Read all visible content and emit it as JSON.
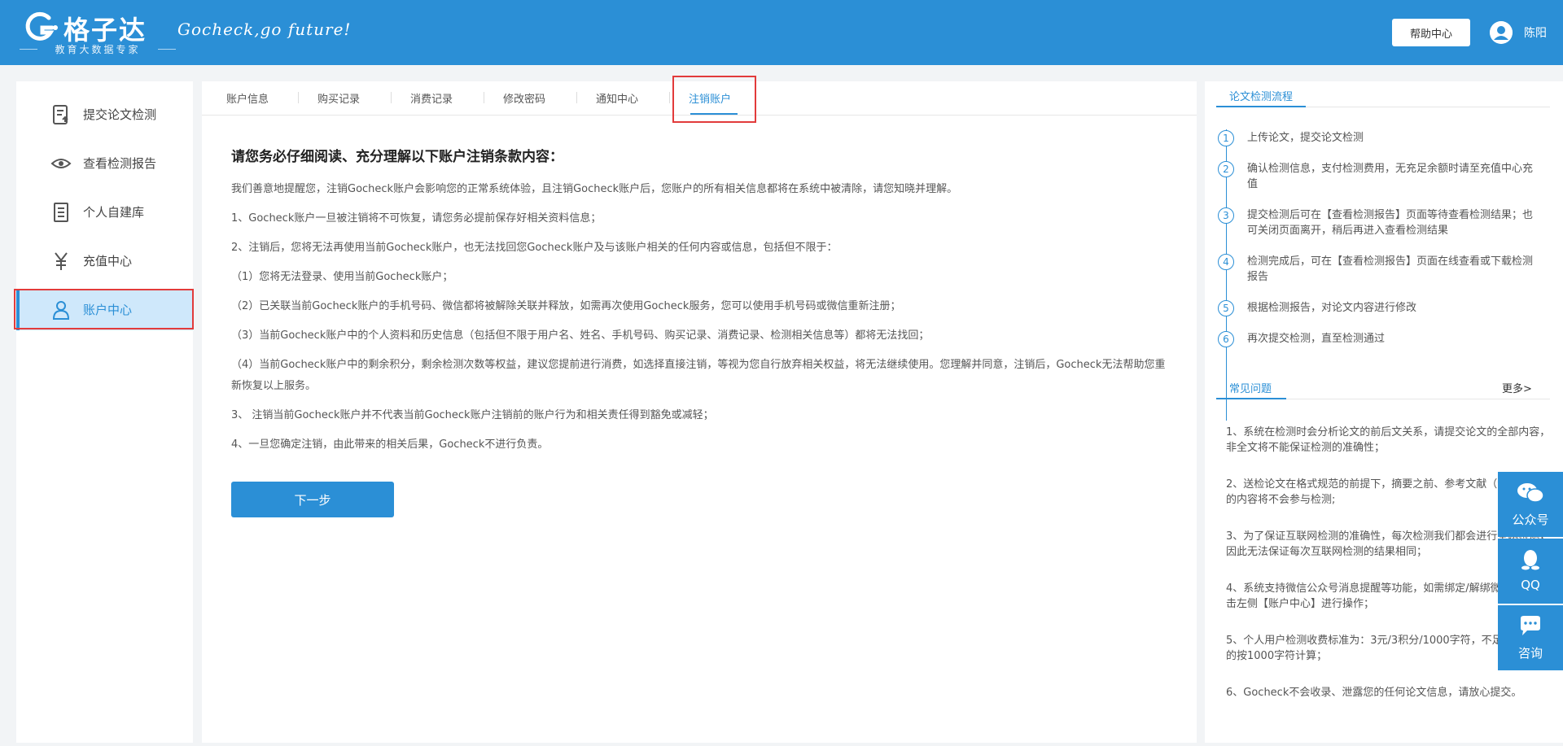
{
  "header": {
    "logo_name": "格子达",
    "logo_sub": "教育大数据专家",
    "slogan": "Gocheck,go future!",
    "help_label": "帮助中心",
    "user_name": "陈阳"
  },
  "sidebar": {
    "items": [
      {
        "label": "提交论文检测",
        "icon": "document-upload-icon"
      },
      {
        "label": "查看检测报告",
        "icon": "eye-icon"
      },
      {
        "label": "个人自建库",
        "icon": "list-document-icon"
      },
      {
        "label": "充值中心",
        "icon": "yen-icon"
      },
      {
        "label": "账户中心",
        "icon": "user-icon",
        "active": true
      }
    ]
  },
  "tabs": [
    {
      "label": "账户信息"
    },
    {
      "label": "购买记录"
    },
    {
      "label": "消费记录"
    },
    {
      "label": "修改密码"
    },
    {
      "label": "通知中心"
    },
    {
      "label": "注销账户",
      "active": true
    }
  ],
  "content": {
    "title": "请您务必仔细阅读、充分理解以下账户注销条款内容：",
    "paragraphs": [
      "我们善意地提醒您，注销Gocheck账户会影响您的正常系统体验，且注销Gocheck账户后，您账户的所有相关信息都将在系统中被清除，请您知晓并理解。",
      "1、Gocheck账户一旦被注销将不可恢复，请您务必提前保存好相关资料信息；",
      "2、注销后，您将无法再使用当前Gocheck账户，也无法找回您Gocheck账户及与该账户相关的任何内容或信息，包括但不限于：",
      "（1）您将无法登录、使用当前Gocheck账户；",
      "（2）已关联当前Gocheck账户的手机号码、微信都将被解除关联并释放，如需再次使用Gocheck服务，您可以使用手机号码或微信重新注册；",
      "（3）当前Gocheck账户中的个人资料和历史信息（包括但不限于用户名、姓名、手机号码、购买记录、消费记录、检测相关信息等）都将无法找回；",
      "（4）当前Gocheck账户中的剩余积分，剩余检测次数等权益，建议您提前进行消费，如选择直接注销，等视为您自行放弃相关权益，将无法继续使用。您理解并同意，注销后，Gocheck无法帮助您重新恢复以上服务。",
      "3、 注销当前Gocheck账户并不代表当前Gocheck账户注销前的账户行为和相关责任得到豁免或减轻；",
      "4、一旦您确定注销，由此带来的相关后果，Gocheck不进行负责。"
    ],
    "next_label": "下一步"
  },
  "right_panel": {
    "process_title": "论文检测流程",
    "steps": [
      {
        "num": "1",
        "text": "上传论文，提交论文检测"
      },
      {
        "num": "2",
        "text": "确认检测信息，支付检测费用，无充足余额时请至充值中心充值"
      },
      {
        "num": "3",
        "text": "提交检测后可在【查看检测报告】页面等待查看检测结果；也可关闭页面离开，稍后再进入查看检测结果"
      },
      {
        "num": "4",
        "text": "检测完成后，可在【查看检测报告】页面在线查看或下载检测报告"
      },
      {
        "num": "5",
        "text": "根据检测报告，对论文内容进行修改"
      },
      {
        "num": "6",
        "text": "再次提交检测，直至检测通过"
      }
    ],
    "faq_title": "常见问题",
    "more_label": "更多>",
    "faqs": [
      "1、系统在检测时会分析论文的前后文关系，请提交论文的全部内容，非全文将不能保证检测的准确性；",
      "2、送检论文在格式规范的前提下，摘要之前、参考文献（含）及之后的内容将不会参与检测;",
      "3、为了保证互联网检测的准确性，每次检测我们都会进行全网检测，因此无法保证每次互联网检测的结果相同；",
      "4、系统支持微信公众号消息提醒等功能，如需绑定/解绑微信，请点击左侧【账户中心】进行操作；",
      "5、个人用户检测收费标准为：3元/3积分/1000字符，不足1000字符的按1000字符计算；",
      "6、Gocheck不会收录、泄露您的任何论文信息，请放心提交。"
    ]
  },
  "float_contacts": [
    {
      "label": "公众号",
      "icon": "wechat-icon"
    },
    {
      "label": "QQ",
      "icon": "qq-penguin-icon"
    },
    {
      "label": "咨询",
      "icon": "chat-bubble-icon"
    }
  ],
  "colors": {
    "brand": "#2b8fd6",
    "highlight": "#e23b3b"
  }
}
